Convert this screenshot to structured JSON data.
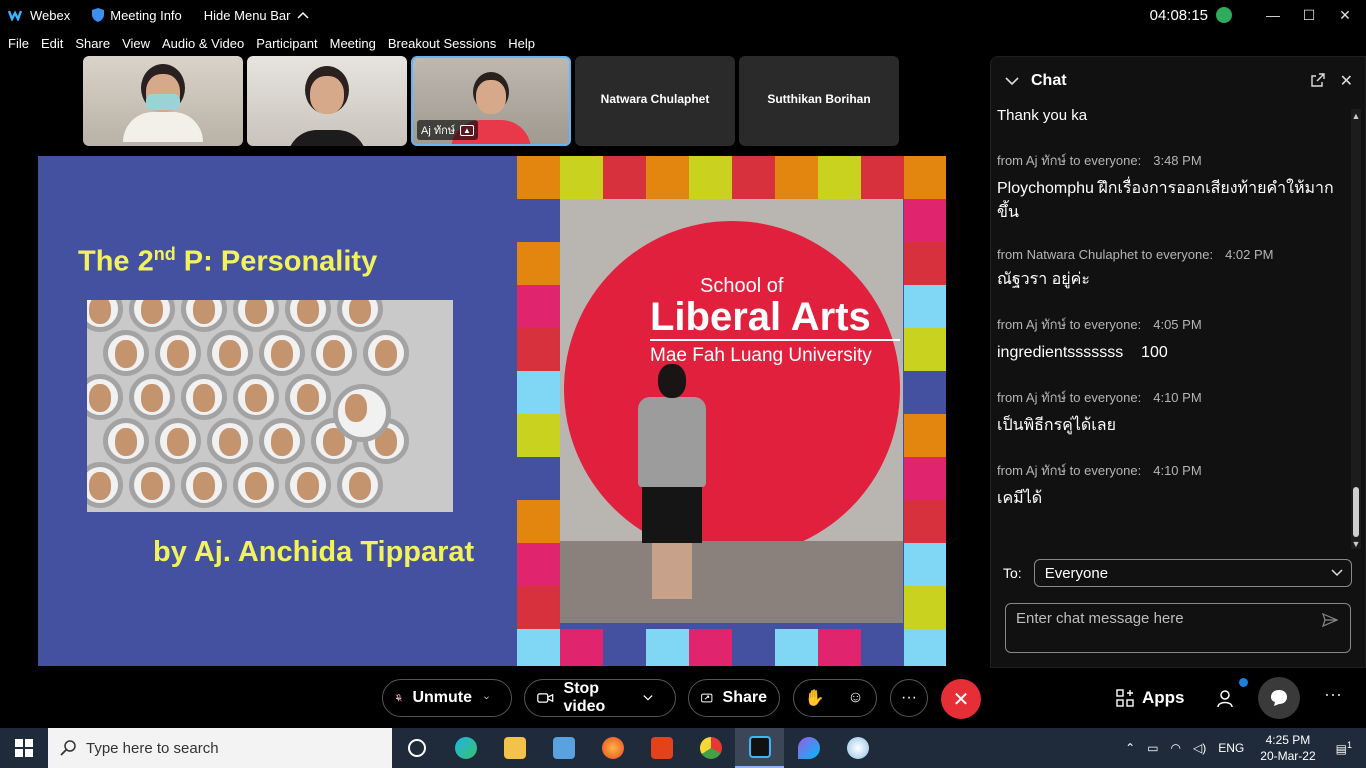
{
  "titlebar": {
    "app_name": "Webex",
    "meeting_info": "Meeting Info",
    "hide_menu": "Hide Menu Bar",
    "clock": "04:08:15",
    "minimize": "—",
    "maximize": "☐",
    "close": "✕"
  },
  "menu": [
    "File",
    "Edit",
    "Share",
    "View",
    "Audio & Video",
    "Participant",
    "Meeting",
    "Breakout Sessions",
    "Help"
  ],
  "participants": [
    {
      "name": ""
    },
    {
      "name": ""
    },
    {
      "name": "Aj ทักษ์"
    },
    {
      "name": "Natwara Chulaphet"
    },
    {
      "name": "Sutthikan Borihan"
    }
  ],
  "slide": {
    "title_pre": "The 2",
    "title_sup": "nd",
    "title_post": " P: Personality",
    "byline": "by Aj. Anchida Tipparat",
    "sign_line1": "School of",
    "sign_line2": "Liberal Arts",
    "sign_line3": "Mae Fah Luang University"
  },
  "colors": {
    "slide_bg": "#4450a0",
    "slide_text": "#f2f25a",
    "end_button": "#e52e35",
    "accent": "#64b5f6"
  },
  "chat": {
    "title": "Chat",
    "first_message": "Thank you ka",
    "messages": [
      {
        "from": "from Aj ทักษ์ to everyone:",
        "time": "3:48 PM",
        "text": "Ploychomphu ฝึกเรื่องการออกเสียงท้ายคำให้มากขึ้น"
      },
      {
        "from": "from Natwara Chulaphet to everyone:",
        "time": "4:02 PM",
        "text": "ณัฐวรา อยู่ค่ะ"
      },
      {
        "from": "from Aj ทักษ์ to everyone:",
        "time": "4:05 PM",
        "text": "ingredientsssssss    100"
      },
      {
        "from": "from Aj ทักษ์ to everyone:",
        "time": "4:10 PM",
        "text": "เป็นพิธีกรคู่ได้เลย"
      },
      {
        "from": "from Aj ทักษ์ to everyone:",
        "time": "4:10 PM",
        "text": "เคมีได้"
      }
    ],
    "to_label": "To:",
    "to_value": "Everyone",
    "input_placeholder": "Enter chat message here"
  },
  "controls": {
    "unmute": "Unmute",
    "stop_video": "Stop video",
    "share": "Share",
    "more": "···",
    "end": "✕",
    "apps": "Apps"
  },
  "taskbar": {
    "search_placeholder": "Type here to search",
    "language": "ENG",
    "time": "4:25 PM",
    "date": "20-Mar-22",
    "notification_count": "1"
  },
  "icons": [
    "webex-logo-icon",
    "shield-icon",
    "chevron-up-icon",
    "mic-muted-icon",
    "camera-icon",
    "share-icon",
    "raise-hand-icon",
    "reaction-icon",
    "end-call-icon",
    "apps-icon",
    "participants-icon",
    "chat-icon",
    "send-icon",
    "search-icon",
    "windows-icon"
  ]
}
